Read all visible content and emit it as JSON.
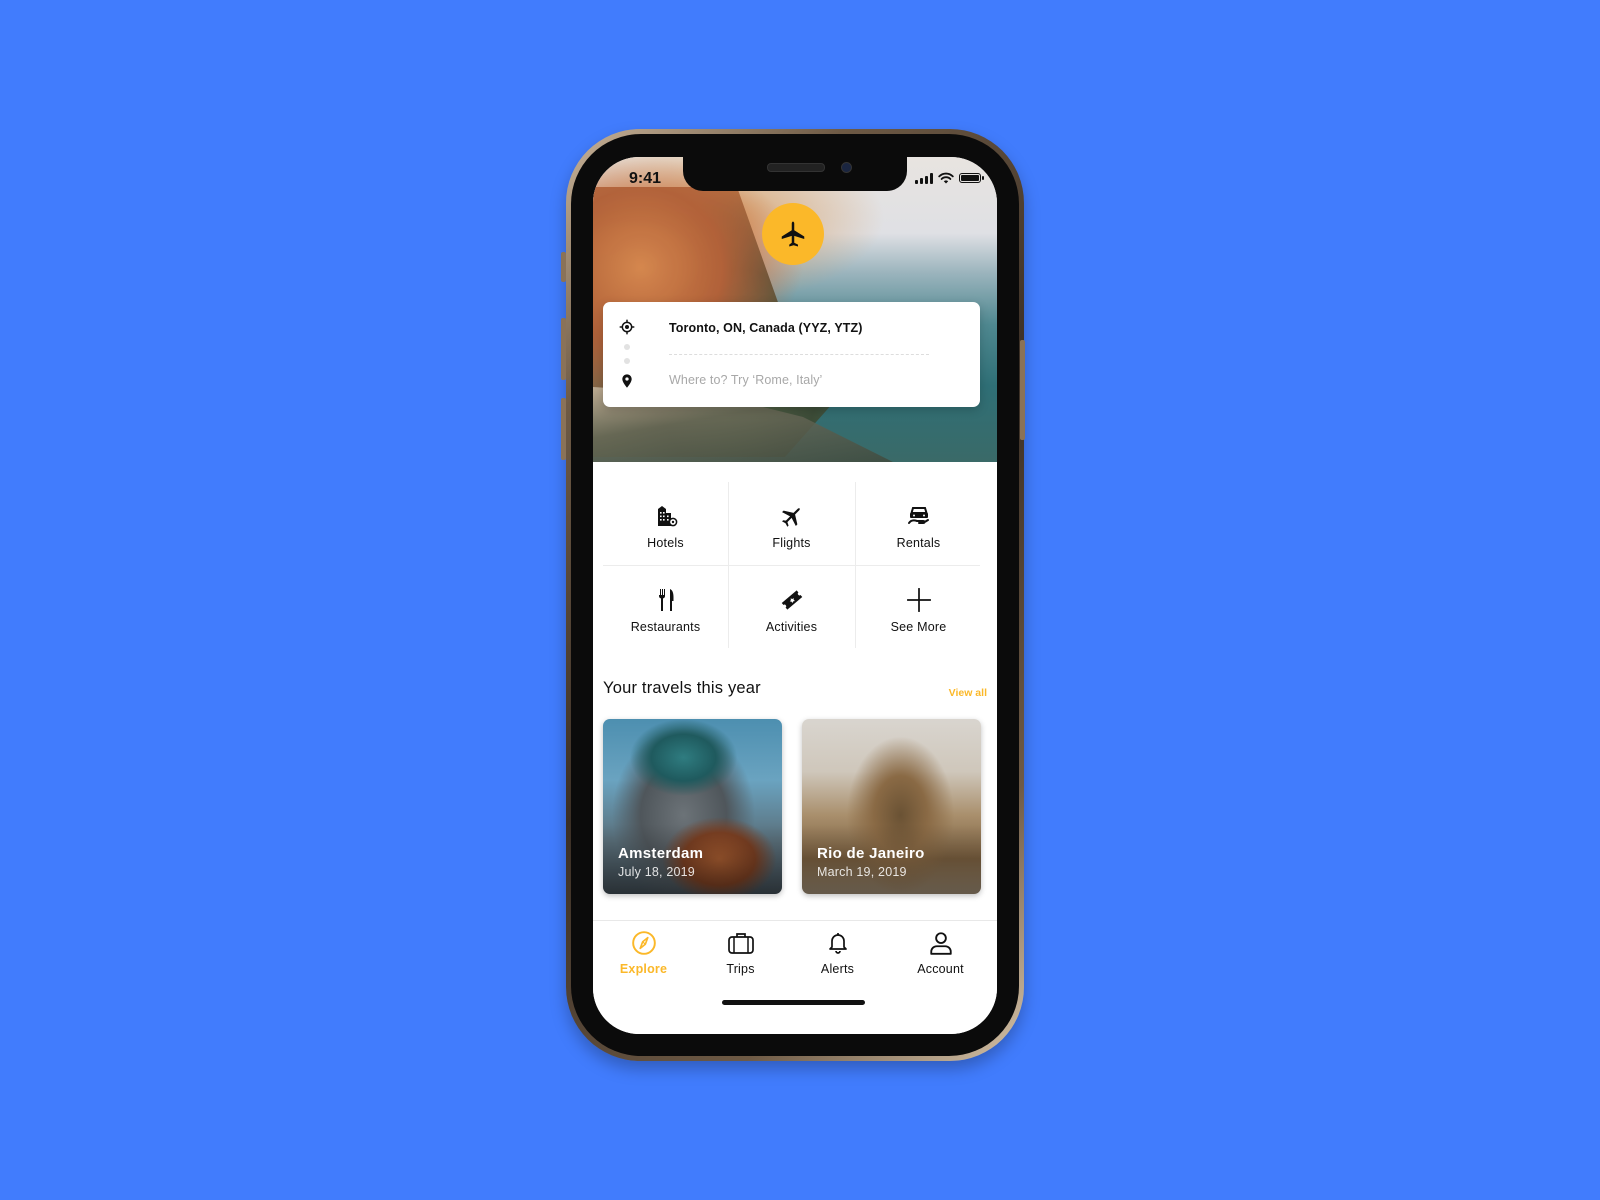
{
  "background_color": "#417cfd",
  "accent_color": "#fbb829",
  "status_bar": {
    "time": "9:41",
    "icons": [
      "signal-icon",
      "wifi-icon",
      "battery-icon"
    ]
  },
  "hero": {
    "fab_icon": "airplane-icon"
  },
  "search": {
    "origin_icon": "crosshair-location-icon",
    "origin_value": "Toronto, ON, Canada (YYZ, YTZ)",
    "destination_icon": "map-pin-icon",
    "destination_placeholder": "Where to? Try ‘Rome, Italy’"
  },
  "categories": [
    {
      "label": "Hotels",
      "icon": "hotel-building-icon"
    },
    {
      "label": "Flights",
      "icon": "airplane-icon"
    },
    {
      "label": "Rentals",
      "icon": "car-rental-icon"
    },
    {
      "label": "Restaurants",
      "icon": "fork-knife-icon"
    },
    {
      "label": "Activities",
      "icon": "ticket-icon"
    },
    {
      "label": "See More",
      "icon": "plus-icon"
    }
  ],
  "travels": {
    "title": "Your travels this year",
    "view_all": "View all",
    "cards": [
      {
        "city": "Amsterdam",
        "date": "July 18, 2019"
      },
      {
        "city": "Rio de Janeiro",
        "date": "March 19, 2019"
      }
    ]
  },
  "tabbar": {
    "active": "Explore",
    "tabs": [
      {
        "label": "Explore",
        "icon": "compass-icon"
      },
      {
        "label": "Trips",
        "icon": "suitcase-icon"
      },
      {
        "label": "Alerts",
        "icon": "bell-icon"
      },
      {
        "label": "Account",
        "icon": "user-icon"
      }
    ]
  }
}
